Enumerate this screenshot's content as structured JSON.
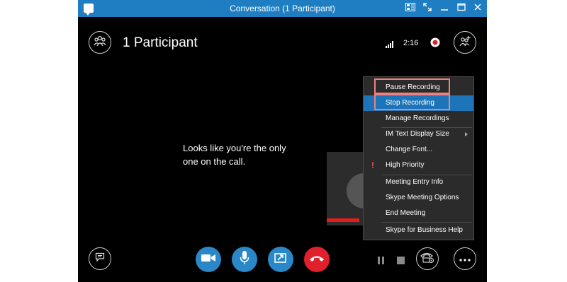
{
  "window": {
    "title": "Conversation (1 Participant)"
  },
  "header": {
    "participants_label": "1 Participant",
    "timer": "2:16"
  },
  "stage": {
    "message_line1": "Looks like you're the only",
    "message_line2": "one on the call."
  },
  "menu": {
    "items": [
      {
        "label": "Pause Recording"
      },
      {
        "label": "Stop Recording"
      },
      {
        "label": "Manage Recordings"
      },
      {
        "label": "IM Text Display Size"
      },
      {
        "label": "Change Font..."
      },
      {
        "label": "High Priority"
      },
      {
        "label": "Meeting Entry Info"
      },
      {
        "label": "Skype Meeting Options"
      },
      {
        "label": "End Meeting"
      },
      {
        "label": "Skype for Business Help"
      }
    ]
  },
  "colors": {
    "titlebar": "#1f7ec2",
    "accent_blue": "#2a88c8",
    "hangup_red": "#e0202a",
    "menu_selected": "#1e74b8",
    "annotation_highlight": "#f08080"
  },
  "icons": {
    "titlebar": [
      "conversation-icon",
      "layout-icon",
      "popout-icon",
      "minimize-icon",
      "maximize-icon",
      "close-icon"
    ],
    "header": [
      "participants-icon",
      "signal-icon",
      "recording-icon",
      "add-people-icon"
    ],
    "footer": [
      "chat-icon",
      "video-icon",
      "microphone-icon",
      "share-screen-icon",
      "hang-up-icon",
      "pause-icon",
      "stop-icon",
      "call-controls-icon",
      "more-options-icon"
    ]
  }
}
